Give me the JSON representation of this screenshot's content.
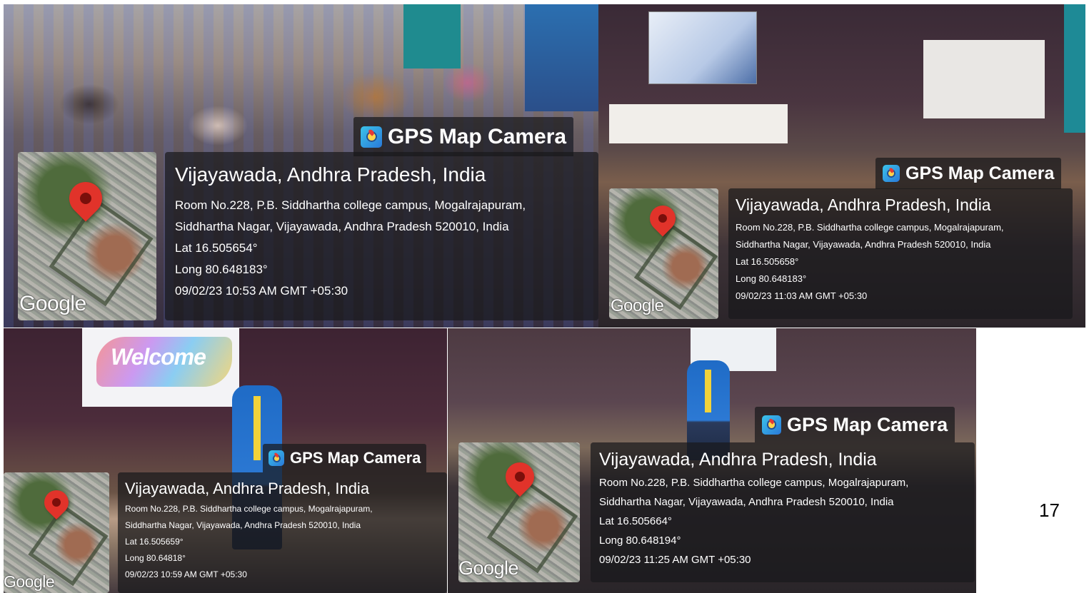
{
  "page_number": "17",
  "photos": [
    {
      "app_badge": "GPS Map Camera",
      "map_logo": "Google",
      "place": "Vijayawada, Andhra Pradesh, India",
      "address_line1": "Room No.228, P.B. Siddhartha college campus, Mogalrajapuram,",
      "address_line2": "Siddhartha Nagar, Vijayawada, Andhra Pradesh 520010, India",
      "lat": "Lat 16.505654°",
      "long": "Long 80.648183°",
      "datetime": "09/02/23 10:53 AM GMT +05:30"
    },
    {
      "app_badge": "GPS Map Camera",
      "map_logo": "Google",
      "place": "Vijayawada, Andhra Pradesh, India",
      "address_line1": "Room No.228, P.B. Siddhartha college campus, Mogalrajapuram,",
      "address_line2": "Siddhartha Nagar, Vijayawada, Andhra Pradesh 520010, India",
      "lat": "Lat 16.505658°",
      "long": "Long 80.648183°",
      "datetime": "09/02/23 11:03 AM GMT +05:30"
    },
    {
      "app_badge": "GPS Map Camera",
      "map_logo": "Google",
      "place": "Vijayawada, Andhra Pradesh, India",
      "address_line1": "Room No.228, P.B. Siddhartha college campus, Mogalrajapuram,",
      "address_line2": "Siddhartha Nagar, Vijayawada, Andhra Pradesh 520010, India",
      "lat": "Lat 16.505659°",
      "long": "Long 80.64818°",
      "datetime": "09/02/23 10:59 AM GMT +05:30",
      "slide_text": "Welcome"
    },
    {
      "app_badge": "GPS Map Camera",
      "map_logo": "Google",
      "place": "Vijayawada, Andhra Pradesh, India",
      "address_line1": "Room No.228, P.B. Siddhartha college campus, Mogalrajapuram,",
      "address_line2": "Siddhartha Nagar, Vijayawada, Andhra Pradesh 520010, India",
      "lat": "Lat 16.505664°",
      "long": "Long 80.648194°",
      "datetime": "09/02/23 11:25 AM GMT +05:30"
    }
  ]
}
